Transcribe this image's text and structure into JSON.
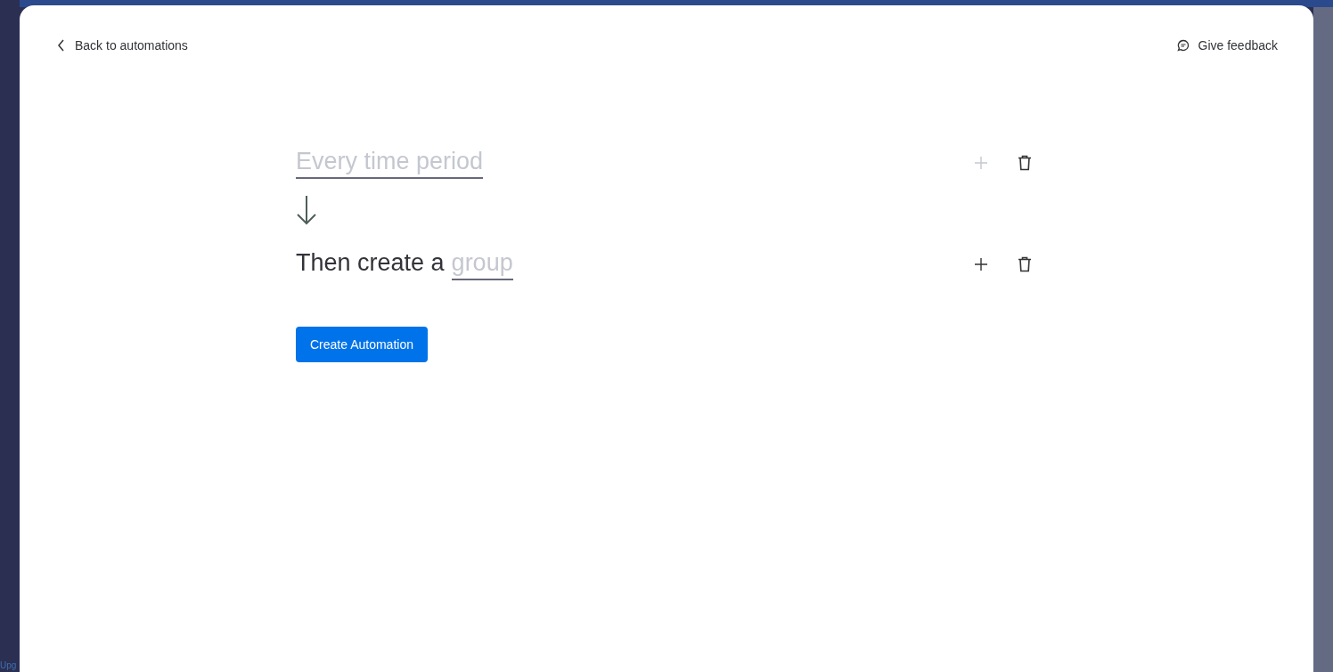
{
  "backdrop": {
    "sidebar_text": "Upg"
  },
  "header": {
    "back_link": "Back to automations",
    "feedback_link": "Give feedback"
  },
  "recipe": [
    {
      "parts": [
        {
          "kind": "blank",
          "text": "Every time period"
        }
      ],
      "add_disabled": true
    },
    {
      "parts": [
        {
          "kind": "text",
          "text": "Then create a"
        },
        {
          "kind": "blank",
          "text": "group"
        }
      ],
      "add_disabled": false
    }
  ],
  "create_button": "Create Automation"
}
